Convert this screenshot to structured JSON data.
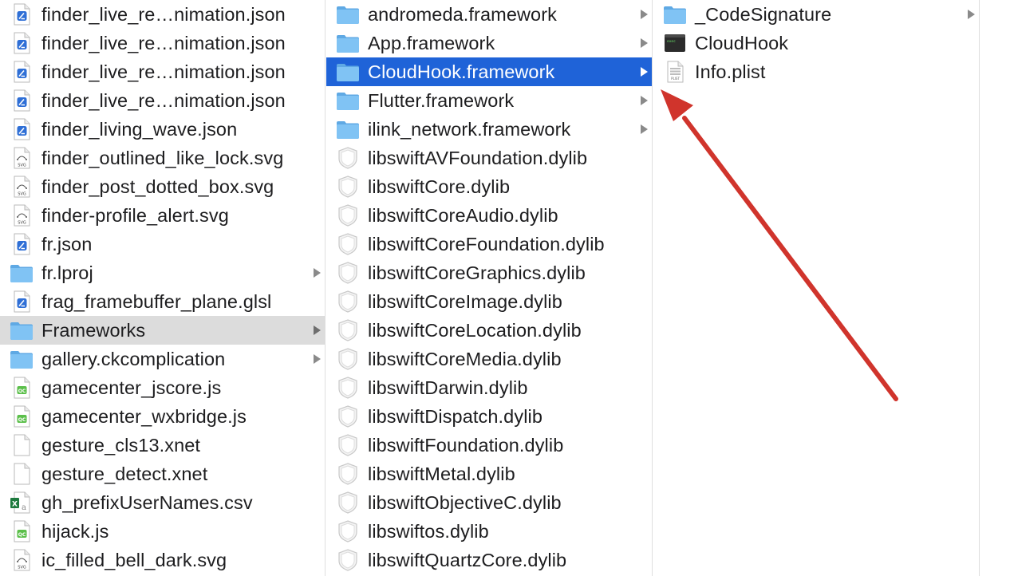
{
  "columns": [
    {
      "items": [
        {
          "name": "finder_live_re…nimation.json",
          "icon": "json-file-icon"
        },
        {
          "name": "finder_live_re…nimation.json",
          "icon": "json-file-icon"
        },
        {
          "name": "finder_live_re…nimation.json",
          "icon": "json-file-icon"
        },
        {
          "name": "finder_live_re…nimation.json",
          "icon": "json-file-icon"
        },
        {
          "name": "finder_living_wave.json",
          "icon": "json-file-icon"
        },
        {
          "name": "finder_outlined_like_lock.svg",
          "icon": "svg-file-icon"
        },
        {
          "name": "finder_post_dotted_box.svg",
          "icon": "svg-file-icon"
        },
        {
          "name": "finder-profile_alert.svg",
          "icon": "svg-file-icon"
        },
        {
          "name": "fr.json",
          "icon": "json-file-icon"
        },
        {
          "name": "fr.lproj",
          "icon": "folder-icon",
          "has_children": true
        },
        {
          "name": "frag_framebuffer_plane.glsl",
          "icon": "json-file-icon"
        },
        {
          "name": "Frameworks",
          "icon": "folder-icon",
          "has_children": true,
          "selected": "gray"
        },
        {
          "name": "gallery.ckcomplication",
          "icon": "folder-icon",
          "has_children": true
        },
        {
          "name": "gamecenter_jscore.js",
          "icon": "js-file-icon"
        },
        {
          "name": "gamecenter_wxbridge.js",
          "icon": "js-file-icon"
        },
        {
          "name": "gesture_cls13.xnet",
          "icon": "blank-file-icon"
        },
        {
          "name": "gesture_detect.xnet",
          "icon": "blank-file-icon"
        },
        {
          "name": "gh_prefixUserNames.csv",
          "icon": "csv-file-icon"
        },
        {
          "name": "hijack.js",
          "icon": "js-file-icon"
        },
        {
          "name": "ic_filled_bell_dark.svg",
          "icon": "svg-file-icon"
        }
      ]
    },
    {
      "items": [
        {
          "name": "andromeda.framework",
          "icon": "folder-icon",
          "has_children": true
        },
        {
          "name": "App.framework",
          "icon": "folder-icon",
          "has_children": true
        },
        {
          "name": "CloudHook.framework",
          "icon": "folder-icon",
          "has_children": true,
          "selected": "blue"
        },
        {
          "name": "Flutter.framework",
          "icon": "folder-icon",
          "has_children": true
        },
        {
          "name": "ilink_network.framework",
          "icon": "folder-icon",
          "has_children": true
        },
        {
          "name": "libswiftAVFoundation.dylib",
          "icon": "dylib-icon"
        },
        {
          "name": "libswiftCore.dylib",
          "icon": "dylib-icon"
        },
        {
          "name": "libswiftCoreAudio.dylib",
          "icon": "dylib-icon"
        },
        {
          "name": "libswiftCoreFoundation.dylib",
          "icon": "dylib-icon"
        },
        {
          "name": "libswiftCoreGraphics.dylib",
          "icon": "dylib-icon"
        },
        {
          "name": "libswiftCoreImage.dylib",
          "icon": "dylib-icon"
        },
        {
          "name": "libswiftCoreLocation.dylib",
          "icon": "dylib-icon"
        },
        {
          "name": "libswiftCoreMedia.dylib",
          "icon": "dylib-icon"
        },
        {
          "name": "libswiftDarwin.dylib",
          "icon": "dylib-icon"
        },
        {
          "name": "libswiftDispatch.dylib",
          "icon": "dylib-icon"
        },
        {
          "name": "libswiftFoundation.dylib",
          "icon": "dylib-icon"
        },
        {
          "name": "libswiftMetal.dylib",
          "icon": "dylib-icon"
        },
        {
          "name": "libswiftObjectiveC.dylib",
          "icon": "dylib-icon"
        },
        {
          "name": "libswiftos.dylib",
          "icon": "dylib-icon"
        },
        {
          "name": "libswiftQuartzCore.dylib",
          "icon": "dylib-icon"
        }
      ]
    },
    {
      "items": [
        {
          "name": "_CodeSignature",
          "icon": "folder-icon",
          "has_children": true
        },
        {
          "name": "CloudHook",
          "icon": "exec-file-icon"
        },
        {
          "name": "Info.plist",
          "icon": "plist-file-icon"
        }
      ]
    }
  ],
  "colors": {
    "selection_blue": "#1f63d8",
    "selection_gray": "#dcdcdc",
    "folder": "#6fb7ee",
    "annotation_arrow": "#d0342c"
  },
  "icon_text": {
    "svg": "SVG",
    "js": "QC",
    "plist": "PLIST",
    "exec": "exec"
  }
}
